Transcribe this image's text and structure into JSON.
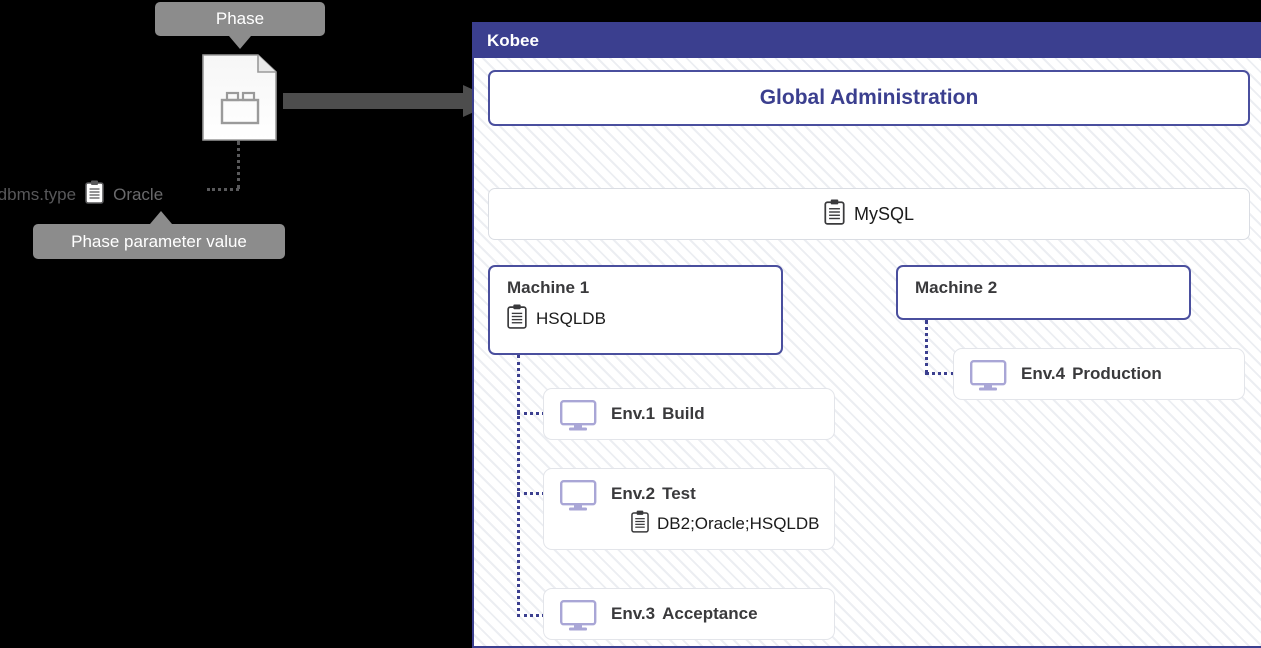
{
  "left": {
    "callout_phase": "Phase",
    "callout_param": "Phase parameter value",
    "phase_icon": "phase-document-icon",
    "parameter": {
      "name": "rdbms.type",
      "icon": "clipboard-icon",
      "value": "Oracle"
    },
    "arrow_icon": "right-arrow"
  },
  "panel": {
    "title": "Kobee",
    "global_admin": "Global Administration",
    "global_db": {
      "icon": "clipboard-icon",
      "label": "MySQL"
    },
    "machines": [
      {
        "name": "Machine 1",
        "db_icon": "clipboard-icon",
        "db": "HSQLDB"
      },
      {
        "name": "Machine 2",
        "db_icon": "",
        "db": ""
      }
    ],
    "environments": [
      {
        "icon": "monitor-icon",
        "id": "Env.1",
        "name": "Build",
        "db_icon": "",
        "db": ""
      },
      {
        "icon": "monitor-icon",
        "id": "Env.2",
        "name": "Test",
        "db_icon": "clipboard-icon",
        "db": "DB2;Oracle;HSQLDB"
      },
      {
        "icon": "monitor-icon",
        "id": "Env.3",
        "name": "Acceptance",
        "db_icon": "",
        "db": ""
      },
      {
        "icon": "monitor-icon",
        "id": "Env.4",
        "name": "Production",
        "db_icon": "",
        "db": ""
      }
    ]
  },
  "colors": {
    "brand_indigo": "#3b3f8f",
    "callout_gray": "#8c8c8c",
    "arrow_gray": "#4d4d4d",
    "monitor_lavender": "#a9a6d6",
    "canvas_black": "#000000"
  }
}
